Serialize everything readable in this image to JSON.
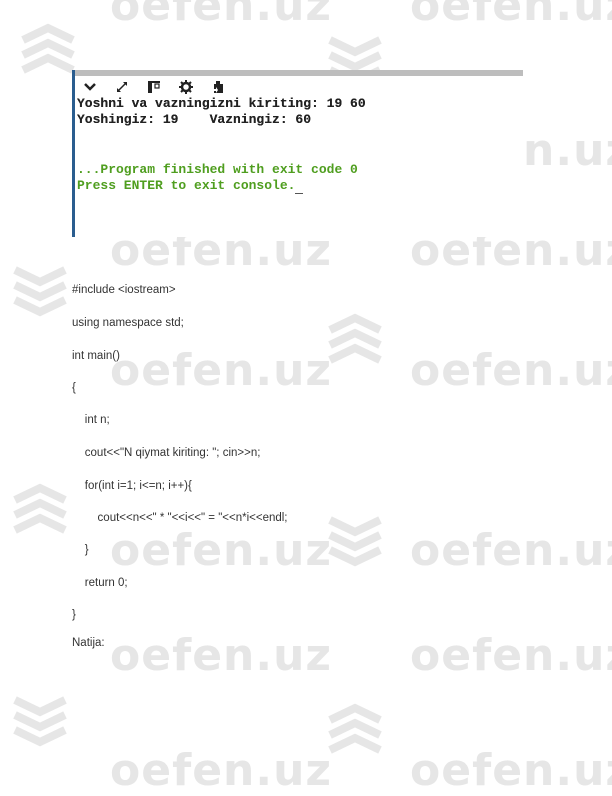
{
  "watermark": {
    "text": "oefen.uz",
    "text_color": "#e6e6e6"
  },
  "terminal": {
    "border_color": "#2a5d8f",
    "toolbar": [
      {
        "icon": "chevron-down-icon",
        "label": "Collapse"
      },
      {
        "icon": "expand-icon",
        "label": "Expand"
      },
      {
        "icon": "panel-icon",
        "label": "Panel"
      },
      {
        "icon": "gear-icon",
        "label": "Settings"
      },
      {
        "icon": "clipboard-icon",
        "label": "Copy"
      }
    ],
    "lines": [
      {
        "text": "Yoshni va vazningizni kiriting: 19 60",
        "style": "dark"
      },
      {
        "text": "Yoshingiz: 19    Vazningiz: 60",
        "style": "dark"
      },
      {
        "text": "...Program finished with exit code 0",
        "style": "green"
      },
      {
        "text": "Press ENTER to exit console.",
        "style": "green"
      }
    ],
    "output_color": "#4f9e1f"
  },
  "code": {
    "lines": [
      "#include <iostream>",
      "using namespace std;",
      "int main()",
      "{",
      "    int n;",
      "    cout<<\"N qiymat kiriting: \"; cin>>n;",
      "    for(int i=1; i<=n; i++){",
      "        cout<<n<<\" * \"<<i<<\" = \"<<n*i<<endl;",
      "    }",
      "    return 0;",
      "}"
    ]
  },
  "result_label": "Natija:"
}
